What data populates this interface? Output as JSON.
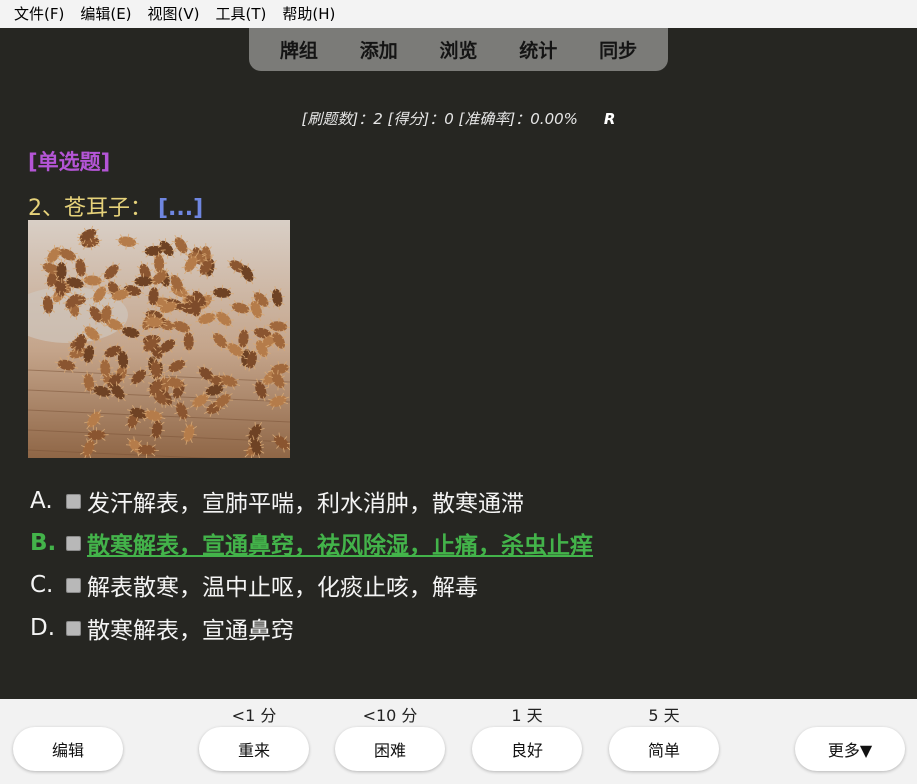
{
  "menu": {
    "items": [
      "文件(F)",
      "编辑(E)",
      "视图(V)",
      "工具(T)",
      "帮助(H)"
    ]
  },
  "nav": {
    "tabs": [
      "牌组",
      "添加",
      "浏览",
      "统计",
      "同步"
    ]
  },
  "stats": {
    "text": "[刷题数]：2  [得分]：0  [准确率]：0.00%",
    "flag": "R"
  },
  "question": {
    "type": "[单选题]",
    "prompt": "2、苍耳子：",
    "blank": "[...]",
    "correct_index": 1,
    "options": [
      {
        "letter": "A.",
        "text": "发汗解表，宣肺平喘，利水消肿，散寒通滞"
      },
      {
        "letter": "B.",
        "text": "散寒解表，宣通鼻窍，祛风除湿，止痛，杀虫止痒"
      },
      {
        "letter": "C.",
        "text": "解表散寒，温中止呕，化痰止咳，解毒"
      },
      {
        "letter": "D.",
        "text": "散寒解表，宣通鼻窍"
      }
    ]
  },
  "bottom": {
    "edit": "编辑",
    "more": "更多▼",
    "answers": [
      {
        "interval": "<1 分",
        "label": "重来"
      },
      {
        "interval": "<10 分",
        "label": "困难"
      },
      {
        "interval": "1 天",
        "label": "良好"
      },
      {
        "interval": "5 天",
        "label": "简单"
      }
    ]
  },
  "colors": {
    "background": "#262622",
    "type_label": "#b455d6",
    "prompt": "#e6d27a",
    "blank": "#6f86e0",
    "correct": "#43b34a"
  }
}
